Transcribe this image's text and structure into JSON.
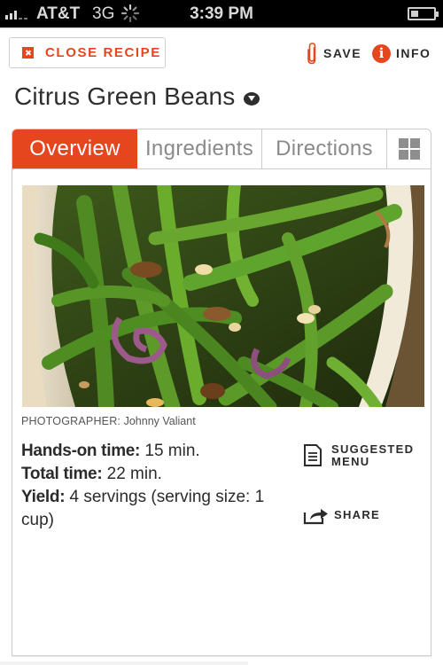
{
  "status_bar": {
    "carrier": "AT&T",
    "network": "3G",
    "time": "3:39 PM",
    "signal_bars": 3,
    "battery_level": 0.35
  },
  "top_bar": {
    "close_label": "CLOSE RECIPE",
    "save_label": "SAVE",
    "info_label": "INFO",
    "info_glyph": "i"
  },
  "recipe": {
    "title": "Citrus Green Beans",
    "photo_alt": "Green beans with caramelized red onions and pine nuts in a white dish",
    "photographer_label": "PHOTOGRAPHER:",
    "photographer_name": "Johnny Valiant",
    "facts": [
      {
        "label": "Hands-on time:",
        "value": "15 min."
      },
      {
        "label": "Total time:",
        "value": "22 min."
      },
      {
        "label": "Yield:",
        "value": "4 servings (serving size: 1 cup)"
      }
    ]
  },
  "tabs": [
    {
      "label": "Overview",
      "active": true
    },
    {
      "label": "Ingredients",
      "active": false
    },
    {
      "label": "Directions",
      "active": false
    }
  ],
  "actions": {
    "suggested_menu_line1": "SUGGESTED",
    "suggested_menu_line2": "MENU",
    "share_label": "SHARE"
  },
  "colors": {
    "accent": "#e5461e",
    "text": "#2b2b2b",
    "tab_inactive": "#8a8a8a",
    "border": "#cdcdcd"
  }
}
